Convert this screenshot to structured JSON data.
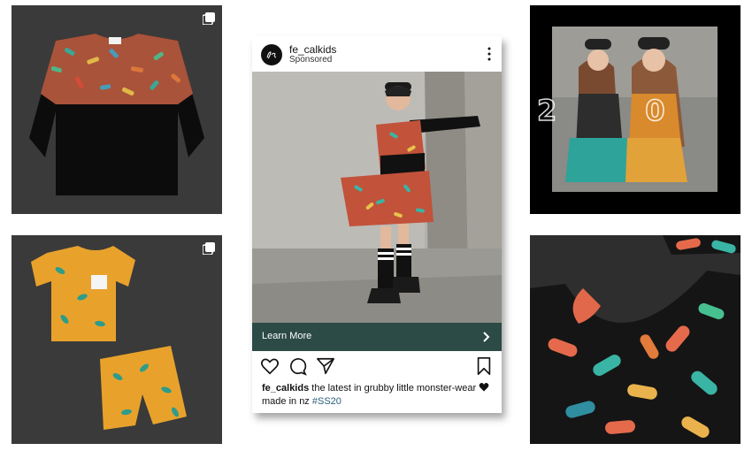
{
  "post": {
    "username": "fe_calkids",
    "sponsored_label": "Sponsored",
    "cta_label": "Learn More",
    "caption_user": "fe_calkids",
    "caption_text": "the latest in grubby little monster-wear",
    "caption_line2": "made in nz",
    "hashtag": "#SS20",
    "accent_color": "#2c4a46"
  },
  "tiles": {
    "top_right_overlay": "2020"
  },
  "icons": [
    "carousel-icon",
    "more-options-icon",
    "chevron-right-icon",
    "heart-icon",
    "comment-icon",
    "share-icon",
    "bookmark-icon",
    "heart-emoji"
  ]
}
